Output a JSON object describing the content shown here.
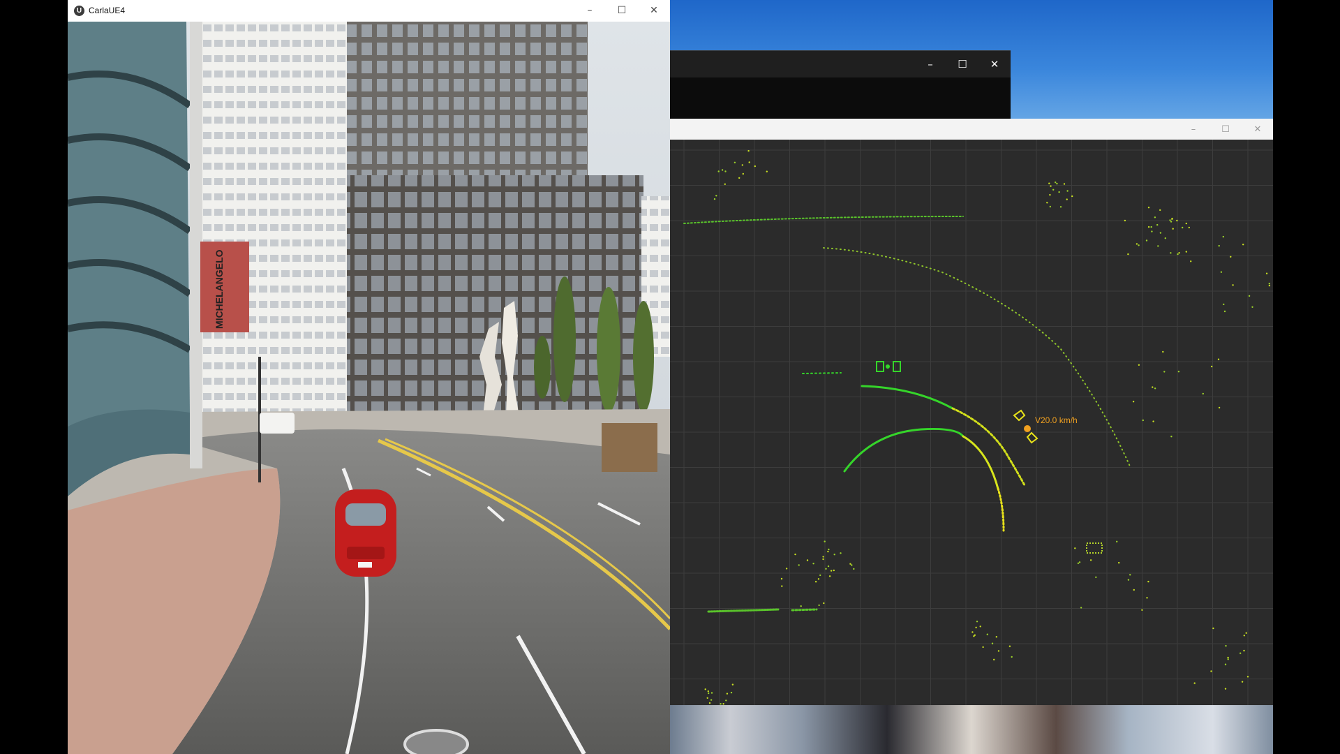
{
  "carla_window": {
    "title": "CarlaUE4",
    "app_icon_glyph": "U",
    "billboard_text": "MICHELANGELO",
    "controls": {
      "minimize": "–",
      "maximize": "☐",
      "close": "✕"
    }
  },
  "console_window": {
    "controls": {
      "minimize": "–",
      "maximize": "☐",
      "close": "✕"
    }
  },
  "radar_window": {
    "controls": {
      "minimize": "–",
      "maximize": "☐",
      "close": "✕"
    },
    "vehicle_speed_label": "V20.0 km/h",
    "colors": {
      "background": "#2b2b2b",
      "grid": "#3d3d3d",
      "near_points": "#35d52a",
      "far_points": "#e8e21a",
      "ego_vehicle": "#f0a020"
    }
  },
  "icons": [
    "carla-app-icon",
    "minimize-icon",
    "maximize-icon",
    "close-icon",
    "ego-vehicle-icon",
    "detected-vehicle-icon"
  ]
}
